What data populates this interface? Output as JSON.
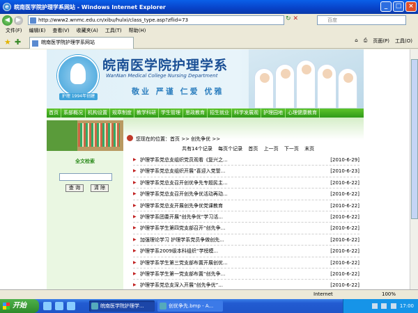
{
  "window": {
    "title": "皖南医学院护理学系网站 - Windows Internet Explorer",
    "tray_label": "关闭"
  },
  "address_bar": {
    "url": "http://www2.wnmc.edu.cn/xibu/hulxi/class_type.asp?zflid=73",
    "search_placeholder": "百度"
  },
  "menu": [
    "文件(F)",
    "编辑(E)",
    "查看(V)",
    "收藏夹(A)",
    "工具(T)",
    "帮助(H)"
  ],
  "tab": {
    "label": "皖南医学院护理学系网站"
  },
  "commandbar": {
    "page": "页面(P)",
    "tools": "工具(O)"
  },
  "site": {
    "title_cn": "皖南医学院护理学系",
    "title_en": "WanNan Medical College Nursing Department",
    "motto": "敬业 严谨 仁爱 优雅",
    "logo_tag": "护理 1994年创建",
    "nav": [
      "首页",
      "系部概况",
      "机构设置",
      "规章制度",
      "教学科研",
      "学生管理",
      "思政教育",
      "招生就业",
      "科学发展观",
      "护理园地",
      "心理健康教育"
    ],
    "search_title": "全文检索",
    "search_button": "查 询",
    "clear_button": "清 除",
    "breadcrumb": "您现在的位置：首页 >> 创先争优 >>",
    "pager": {
      "total": "共有14个记录",
      "per_page": "每页个记录",
      "first": "首页",
      "prev": "上一页",
      "next": "下一页",
      "last": "末页"
    },
    "news": [
      {
        "title": "护理学系党总支组织党员观看《复兴之...",
        "date": "[2010-6-29]"
      },
      {
        "title": "护理学系党总支组织开展“喜迎入党誓...",
        "date": "[2010-6-23]"
      },
      {
        "title": "护理学系党总支召开创优争先专题民主...",
        "date": "[2010-6-22]"
      },
      {
        "title": "护理学系党总支召开创先争优活动再动...",
        "date": "[2010-6-22]"
      },
      {
        "title": "护理学系党总支开展创先争优党课教育",
        "date": "[2010-6-22]"
      },
      {
        "title": "护理学系团委开展“创先争优”学习活...",
        "date": "[2010-6-22]"
      },
      {
        "title": "护理学系学生第四党支部召开“创先争...",
        "date": "[2010-6-22]"
      },
      {
        "title": "加强理论学习 护理学系党员争做创先...",
        "date": "[2010-6-22]"
      },
      {
        "title": "护理学系2009级本科组织“学榜模...",
        "date": "[2010-6-22]"
      },
      {
        "title": "护理学系学生第三党支部布置开展创优...",
        "date": "[2010-6-22]"
      },
      {
        "title": "护理学系学生第一党支部布置“创先争...",
        "date": "[2010-6-22]"
      },
      {
        "title": "护理学系党总支深入开展“创先争优”...",
        "date": "[2010-6-22]"
      }
    ]
  },
  "statusbar": {
    "zone": "Internet",
    "zoom": "100%"
  },
  "taskbar": {
    "start": "开始",
    "tasks": [
      "皖南医学院护理学...",
      "创优争先.bmp - A..."
    ],
    "clock": "17:00"
  },
  "colors": {
    "nav_green": "#3aa620",
    "title_blue": "#1a4f95",
    "titlebar": "#0842c8"
  }
}
